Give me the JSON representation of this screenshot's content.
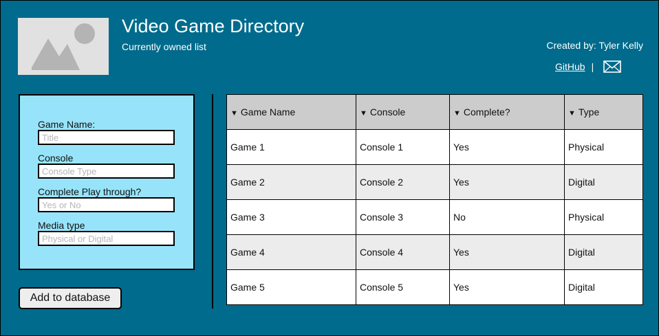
{
  "header": {
    "title": "Video Game Directory",
    "subtitle": "Currently owned list",
    "credit": "Created by: Tyler Kelly",
    "github_label": "GitHub",
    "separator": "|",
    "logo_icon": "image-placeholder-icon",
    "mail_icon": "envelope-icon"
  },
  "form": {
    "fields": [
      {
        "label": "Game Name:",
        "placeholder": "Title",
        "value": ""
      },
      {
        "label": "Console",
        "placeholder": "Console Type",
        "value": ""
      },
      {
        "label": "Complete Play through?",
        "placeholder": "Yes or No",
        "value": ""
      },
      {
        "label": "Media type",
        "placeholder": "Physical or Digital",
        "value": ""
      }
    ],
    "submit_label": "Add to database"
  },
  "table": {
    "sort_icon": "triangle-down-icon",
    "columns": [
      "Game Name",
      "Console",
      "Complete?",
      "Type"
    ],
    "rows": [
      [
        "Game 1",
        "Console 1",
        "Yes",
        "Physical"
      ],
      [
        "Game 2",
        "Console 2",
        "Yes",
        "Digital"
      ],
      [
        "Game 3",
        "Console 3",
        "No",
        "Physical"
      ],
      [
        "Game 4",
        "Console 4",
        "Yes",
        "Digital"
      ],
      [
        "Game 5",
        "Console 5",
        "Yes",
        "Digital"
      ]
    ]
  },
  "colors": {
    "background": "#006b8c",
    "form_panel": "#97e4fa",
    "header_row": "#cccccc",
    "alt_row": "#ececec"
  }
}
